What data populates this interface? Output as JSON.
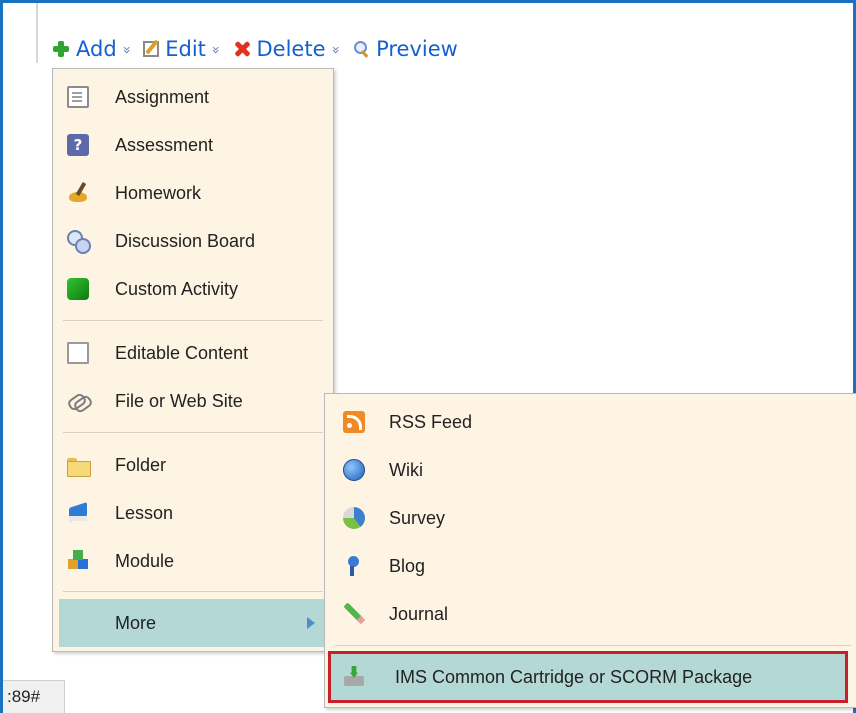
{
  "toolbar": {
    "add_label": "Add",
    "edit_label": "Edit",
    "delete_label": "Delete",
    "preview_label": "Preview",
    "dropdown_glyph": "»"
  },
  "main_menu": {
    "items": [
      {
        "label": "Assignment",
        "icon": "document-icon"
      },
      {
        "label": "Assessment",
        "icon": "question-icon"
      },
      {
        "label": "Homework",
        "icon": "brush-icon"
      },
      {
        "label": "Discussion Board",
        "icon": "discussion-icon"
      },
      {
        "label": "Custom Activity",
        "icon": "cube-icon"
      },
      {
        "label": "Editable Content",
        "icon": "page-icon"
      },
      {
        "label": "File or Web Site",
        "icon": "link-icon"
      },
      {
        "label": "Folder",
        "icon": "folder-icon"
      },
      {
        "label": "Lesson",
        "icon": "lesson-icon"
      },
      {
        "label": "Module",
        "icon": "module-icon"
      }
    ],
    "more_label": "More"
  },
  "sub_menu": {
    "items": [
      {
        "label": "RSS Feed",
        "icon": "rss-icon"
      },
      {
        "label": "Wiki",
        "icon": "globe-icon"
      },
      {
        "label": "Survey",
        "icon": "survey-icon"
      },
      {
        "label": "Blog",
        "icon": "blog-icon"
      },
      {
        "label": "Journal",
        "icon": "pencil-icon"
      }
    ],
    "highlighted_label": "IMS Common Cartridge or SCORM Package",
    "highlighted_icon": "package-icon"
  },
  "status": {
    "text": ":89#"
  },
  "colors": {
    "link_blue": "#1560d0",
    "menu_bg": "#fdf4e4",
    "hover_teal": "#b3d8d6",
    "highlight_red": "#c8202a",
    "frame_blue": "#1a73c0"
  }
}
